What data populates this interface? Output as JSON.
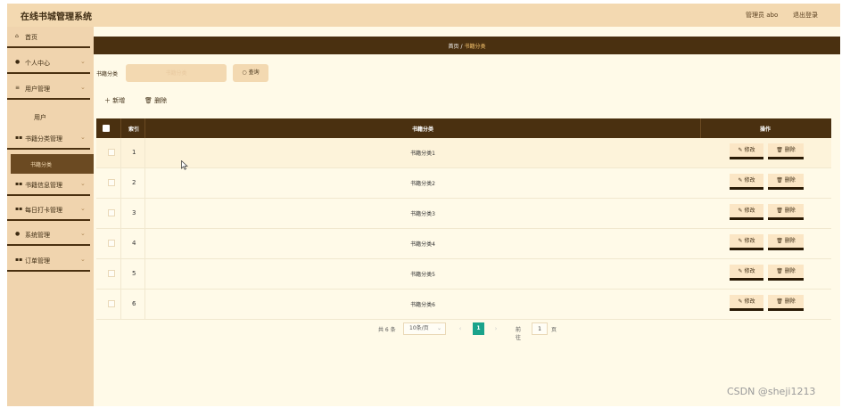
{
  "app": {
    "title": "在线书城管理系统",
    "admin_label": "管理员 abo",
    "logout": "退出登录"
  },
  "sidebar": {
    "items": [
      {
        "label": "首页",
        "icon": "home-icon"
      },
      {
        "label": "个人中心",
        "icon": "user-icon"
      },
      {
        "label": "用户管理",
        "icon": "list-icon"
      },
      {
        "label": "用户",
        "icon": ""
      },
      {
        "label": "书籍分类管理",
        "icon": "grid-icon"
      },
      {
        "label": "书籍分类",
        "icon": ""
      },
      {
        "label": "书籍信息管理",
        "icon": "grid-icon"
      },
      {
        "label": "每日打卡管理",
        "icon": "grid-icon"
      },
      {
        "label": "系统管理",
        "icon": "gear-icon"
      },
      {
        "label": "订单管理",
        "icon": "grid-icon"
      }
    ],
    "active": "书籍分类"
  },
  "breadcrumb": {
    "home": "首页",
    "separator": "/",
    "current": "书籍分类"
  },
  "search": {
    "label": "书籍分类",
    "placeholder": "书籍分类",
    "button": "查询"
  },
  "actions": {
    "add": "新增",
    "delete": "删除"
  },
  "table": {
    "headers": {
      "index": "索引",
      "name": "书籍分类",
      "ops": "操作"
    },
    "rows": [
      {
        "index": "1",
        "name": "书籍分类1"
      },
      {
        "index": "2",
        "name": "书籍分类2"
      },
      {
        "index": "3",
        "name": "书籍分类3"
      },
      {
        "index": "4",
        "name": "书籍分类4"
      },
      {
        "index": "5",
        "name": "书籍分类5"
      },
      {
        "index": "6",
        "name": "书籍分类6"
      }
    ],
    "edit_label": "修改",
    "delete_label": "删除"
  },
  "pagination": {
    "total": "共 6 条",
    "page_size": "10条/页",
    "current_page": "1",
    "goto_label": "前往",
    "goto_value": "1",
    "goto_unit": "页"
  },
  "watermark": "CSDN @sheji1213",
  "colors": {
    "topbar": "#f3d9b1",
    "sidebar": "#f0d4ae",
    "dark_brown": "#4a3010",
    "content_bg": "#fffae8",
    "page_active": "#1aa38b"
  }
}
